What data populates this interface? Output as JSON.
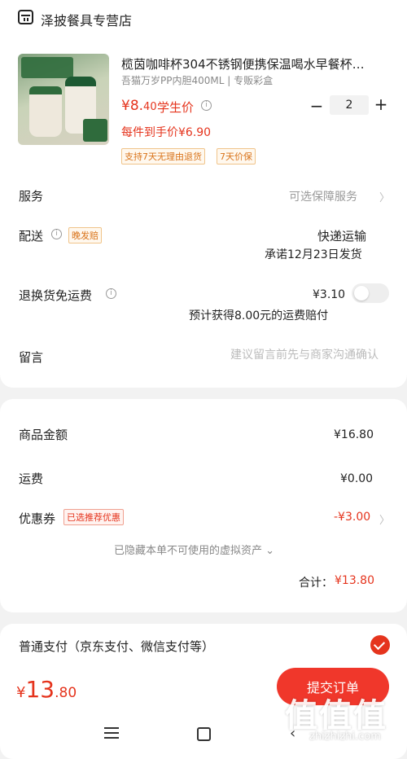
{
  "shop": {
    "name": "泽披餐具专营店",
    "icon": "shop-icon"
  },
  "product": {
    "title": "榄茵咖啡杯304不锈钢便携保温喝水早餐杯…",
    "spec": "吾猫万岁PP内胆400ML | 专贩彩盒",
    "price_main": "¥8.",
    "price_dec": "40",
    "student_label": "学生价",
    "per_piece": "每件到手价¥6.90",
    "quantity": "2",
    "tags": [
      "支持7天无理由退货",
      "7天价保"
    ]
  },
  "service": {
    "label": "服务",
    "value": "可选保障服务"
  },
  "shipping": {
    "label": "配送",
    "late_tag": "晚发赔",
    "method": "快递运输",
    "promise": "承诺12月23日发货"
  },
  "return_fee": {
    "label": "退换货免运费",
    "price": "¥3.10",
    "note": "预计获得8.00元的运费赔付",
    "toggle_on": false
  },
  "message": {
    "label": "留言",
    "placeholder": "建议留言前先与商家沟通确认"
  },
  "summary": {
    "amount_label": "商品金额",
    "amount": "¥16.80",
    "fee_label": "运费",
    "fee": "¥0.00",
    "coupon_label": "优惠券",
    "coupon_tag": "已选推荐优惠",
    "coupon_value": "-¥3.00",
    "hidden_assets": "已隐藏本单不可使用的虚拟资产",
    "total_label": "合计：",
    "total": "¥13.80"
  },
  "payment": {
    "label": "普通支付（京东支付、微信支付等）",
    "selected": true
  },
  "bottom": {
    "currency": "¥",
    "price_int": "13",
    "price_dec": ".80",
    "submit": "提交订单"
  },
  "watermark": {
    "logo": "值值值",
    "url": "zhizhizhi.com"
  },
  "colors": {
    "accent": "#e5341d",
    "tag_orange": "#d9731a",
    "background": "#f2f2f2"
  }
}
